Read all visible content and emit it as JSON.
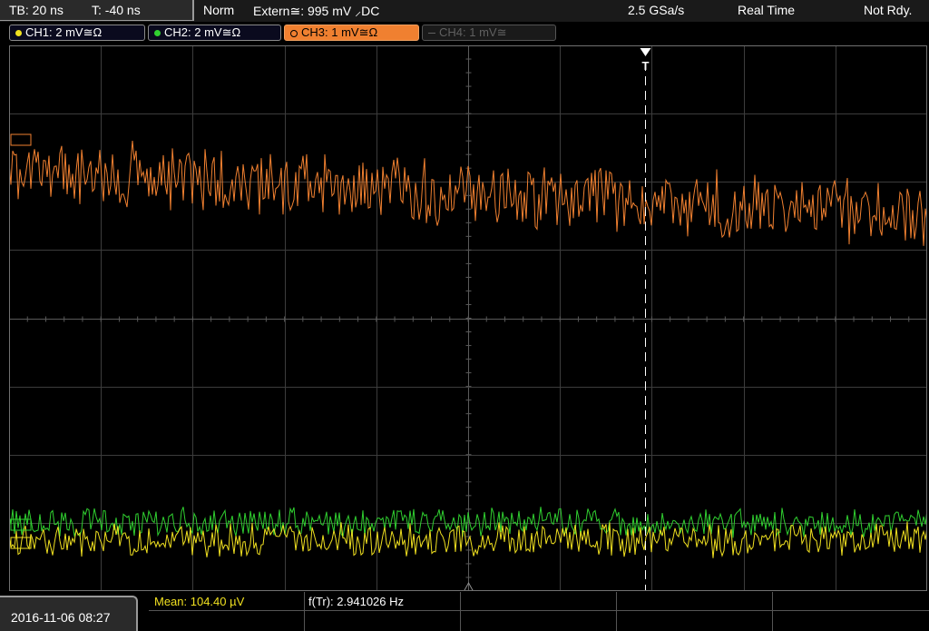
{
  "status": {
    "timebase": "TB: 20 ns",
    "trigger_time": "T: -40 ns",
    "mode": "Norm",
    "trigger_source": "Extern≅: 995 mV ⸝DC",
    "sample_rate": "2.5 GSa/s",
    "acquisition": "Real Time",
    "state": "Not Rdy."
  },
  "channels": [
    {
      "label": "CH1: 2 mV≅Ω",
      "color": "#f0e020",
      "active": false,
      "enabled": true
    },
    {
      "label": "CH2: 2 mV≅Ω",
      "color": "#30d030",
      "active": false,
      "enabled": true
    },
    {
      "label": "CH3: 1 mV≅Ω",
      "color": "#f08030",
      "active": true,
      "enabled": true
    },
    {
      "label": "CH4: 1 mV≅",
      "color": "#606060",
      "active": false,
      "enabled": false
    }
  ],
  "measurements": {
    "date": "2016-11-06 08:27",
    "mean": "Mean: 104.40 µV",
    "freq": "f(Tr): 2.941026 Hz"
  },
  "markers": {
    "trigger_marker": "T"
  },
  "colors": {
    "ch1": "#f0e020",
    "ch2": "#30d030",
    "ch3": "#f08030",
    "grid": "#3c3c3c",
    "grid_center": "#5a5a5a"
  }
}
